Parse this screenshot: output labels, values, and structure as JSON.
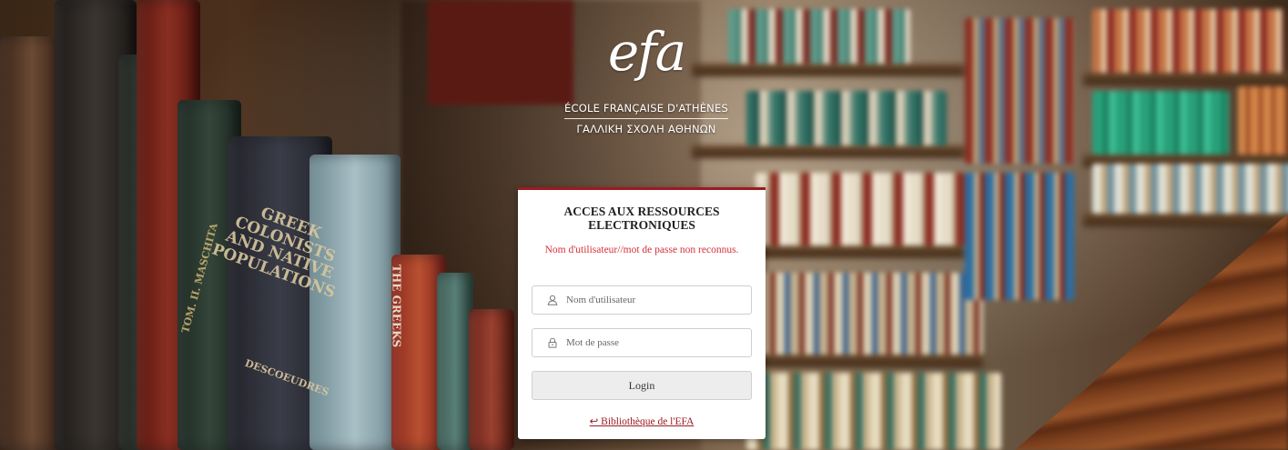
{
  "colors": {
    "accent": "#9b1b22",
    "error": "#d6303a",
    "button_bg": "#ededed",
    "card_bg": "#ffffff"
  },
  "background": {
    "book_spines": {
      "greek_colonists": "GREEK COLONISTS AND NATIVE POPULATIONS",
      "author": "DESCOEUDRES",
      "the_greeks": "THE GREEKS",
      "maschita": "ΤΟΜ. II. MASCHITA"
    }
  },
  "logo": {
    "mark": "efa",
    "name_fr": "ÉCOLE FRANÇAISE D'ATHÈNES",
    "name_gr": "ΓΑΛΛΙΚΗ ΣΧΟΛΗ ΑΘΗΝΩΝ"
  },
  "login": {
    "title": "ACCES AUX RESSOURCES ELECTRONIQUES",
    "error": "Nom d'utilisateur//mot de passe non reconnus.",
    "username": {
      "placeholder": "Nom d'utilisateur",
      "value": "",
      "icon": "user-icon"
    },
    "password": {
      "placeholder": "Mot de passe",
      "value": "",
      "icon": "lock-icon"
    },
    "submit_label": "Login",
    "back_link": "↩ Bibliothèque de l'EFA"
  }
}
